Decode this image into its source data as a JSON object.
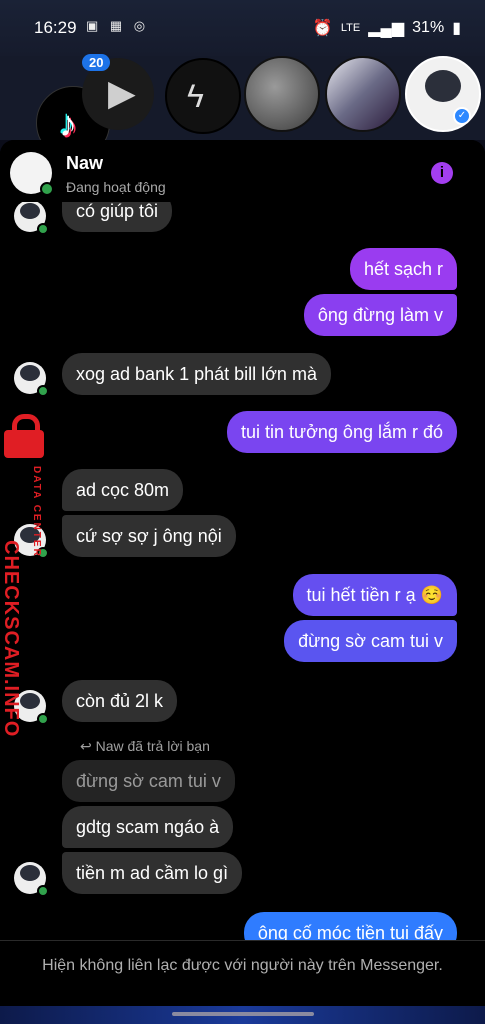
{
  "status_bar": {
    "time": "16:29",
    "battery": "31%",
    "network": "LTE"
  },
  "bubbles": {
    "badge_count": "20"
  },
  "header": {
    "name": "Naw",
    "status": "Đang hoạt động"
  },
  "colors": {
    "out_gradient_top": "#9b3df0",
    "out_gradient_mid": "#6a4bf0",
    "out_gradient_bottom": "#2f7cff",
    "incoming": "#303030",
    "online": "#31a24c"
  },
  "messages": [
    {
      "dir": "in",
      "text": "có giúp tôi"
    },
    {
      "dir": "out",
      "text": "hết sạch r"
    },
    {
      "dir": "out",
      "text": "ông đừng làm v"
    },
    {
      "dir": "in",
      "text": "xog ad bank 1 phát bill lớn mà"
    },
    {
      "dir": "out",
      "text": "tui tin tưởng ông lắm r đó"
    },
    {
      "dir": "in",
      "text": "ad cọc 80m"
    },
    {
      "dir": "in",
      "text": "cứ sợ sợ j ông nội"
    },
    {
      "dir": "out",
      "text": "tui hết tiền r ạ ☺️"
    },
    {
      "dir": "out",
      "text": "đừng sờ cam tui v"
    },
    {
      "dir": "in",
      "text": "còn đủ 2l k"
    },
    {
      "dir": "in",
      "text": "gdtg scam ngáo à"
    },
    {
      "dir": "in",
      "text": "tiền m ad cầm lo gì"
    },
    {
      "dir": "out",
      "text": "ông cố móc tiền tui đấy"
    }
  ],
  "reply": {
    "label": "Naw đã trả lời bạn",
    "quoted": "đừng sờ cam tui v"
  },
  "footer": {
    "text": "Hiện không liên lạc được với người này trên Messenger."
  },
  "watermark": {
    "main": "CHECKSCAM.INFO",
    "sub": "DATA CENTER"
  },
  "icons": [
    "tiktok-icon",
    "play-icon",
    "messenger-icon",
    "info-icon",
    "reply-arrow-icon",
    "lock-icon"
  ]
}
